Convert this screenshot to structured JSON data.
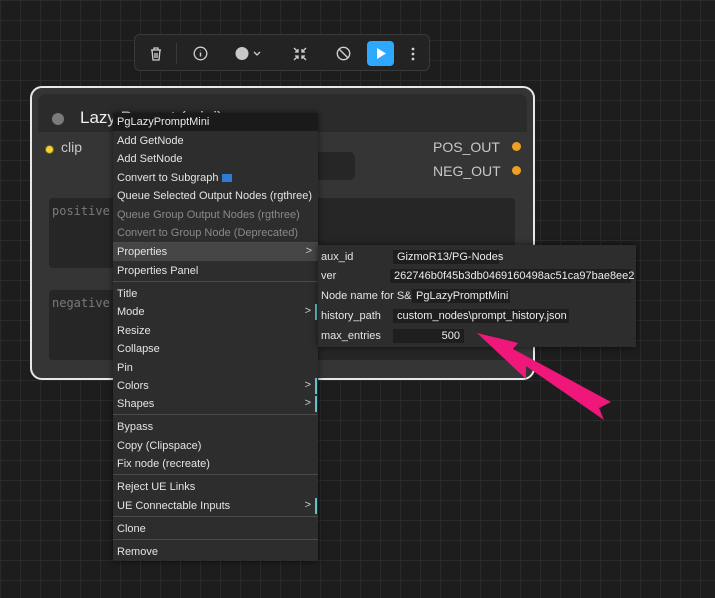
{
  "toolbar": {
    "buttons": [
      {
        "name": "trash-icon"
      },
      {
        "name": "info-icon"
      },
      {
        "name": "color-circle-icon"
      },
      {
        "name": "collapse-icon"
      },
      {
        "name": "bypass-icon"
      },
      {
        "name": "run-icon"
      },
      {
        "name": "more-icon"
      }
    ],
    "run_color": "#2ea8ff"
  },
  "node": {
    "title": "Lazy Prompt (mini)",
    "input_label": "clip",
    "outputs": [
      "POS_OUT",
      "NEG_OUT"
    ],
    "positive_placeholder": "positive",
    "negative_placeholder": "negative",
    "input_color": "#f2d33c",
    "output_color": "#f0a020"
  },
  "menu": {
    "header": "PgLazyPromptMini",
    "items": [
      {
        "label": "Add GetNode"
      },
      {
        "label": "Add SetNode"
      },
      {
        "label": "Convert to Subgraph"
      },
      {
        "label": "Queue Selected Output Nodes (rgthree)"
      },
      {
        "label": "Queue Group Output Nodes (rgthree)"
      },
      {
        "label": "Convert to Group Node (Deprecated)"
      },
      {
        "label": "Properties"
      },
      {
        "label": "Properties Panel"
      },
      {
        "label": "Title"
      },
      {
        "label": "Mode"
      },
      {
        "label": "Resize"
      },
      {
        "label": "Collapse"
      },
      {
        "label": "Pin"
      },
      {
        "label": "Colors"
      },
      {
        "label": "Shapes"
      },
      {
        "label": "Bypass"
      },
      {
        "label": "Copy (Clipspace)"
      },
      {
        "label": "Fix node (recreate)"
      },
      {
        "label": "Reject UE Links"
      },
      {
        "label": "UE Connectable Inputs"
      },
      {
        "label": "Clone"
      },
      {
        "label": "Remove"
      }
    ],
    "submenu_arrow": ">"
  },
  "properties": [
    {
      "key": "aux_id",
      "value": "GizmoR13/PG-Nodes"
    },
    {
      "key": "ver",
      "value": "262746b0f45b3db0469160498ac51ca97bae8ee2"
    },
    {
      "key": "Node name for S&R",
      "value": "PgLazyPromptMini"
    },
    {
      "key": "history_path",
      "value": "custom_nodes\\prompt_history.json"
    },
    {
      "key": "max_entries",
      "value": "500"
    }
  ],
  "annotation_color": "#f0177a"
}
